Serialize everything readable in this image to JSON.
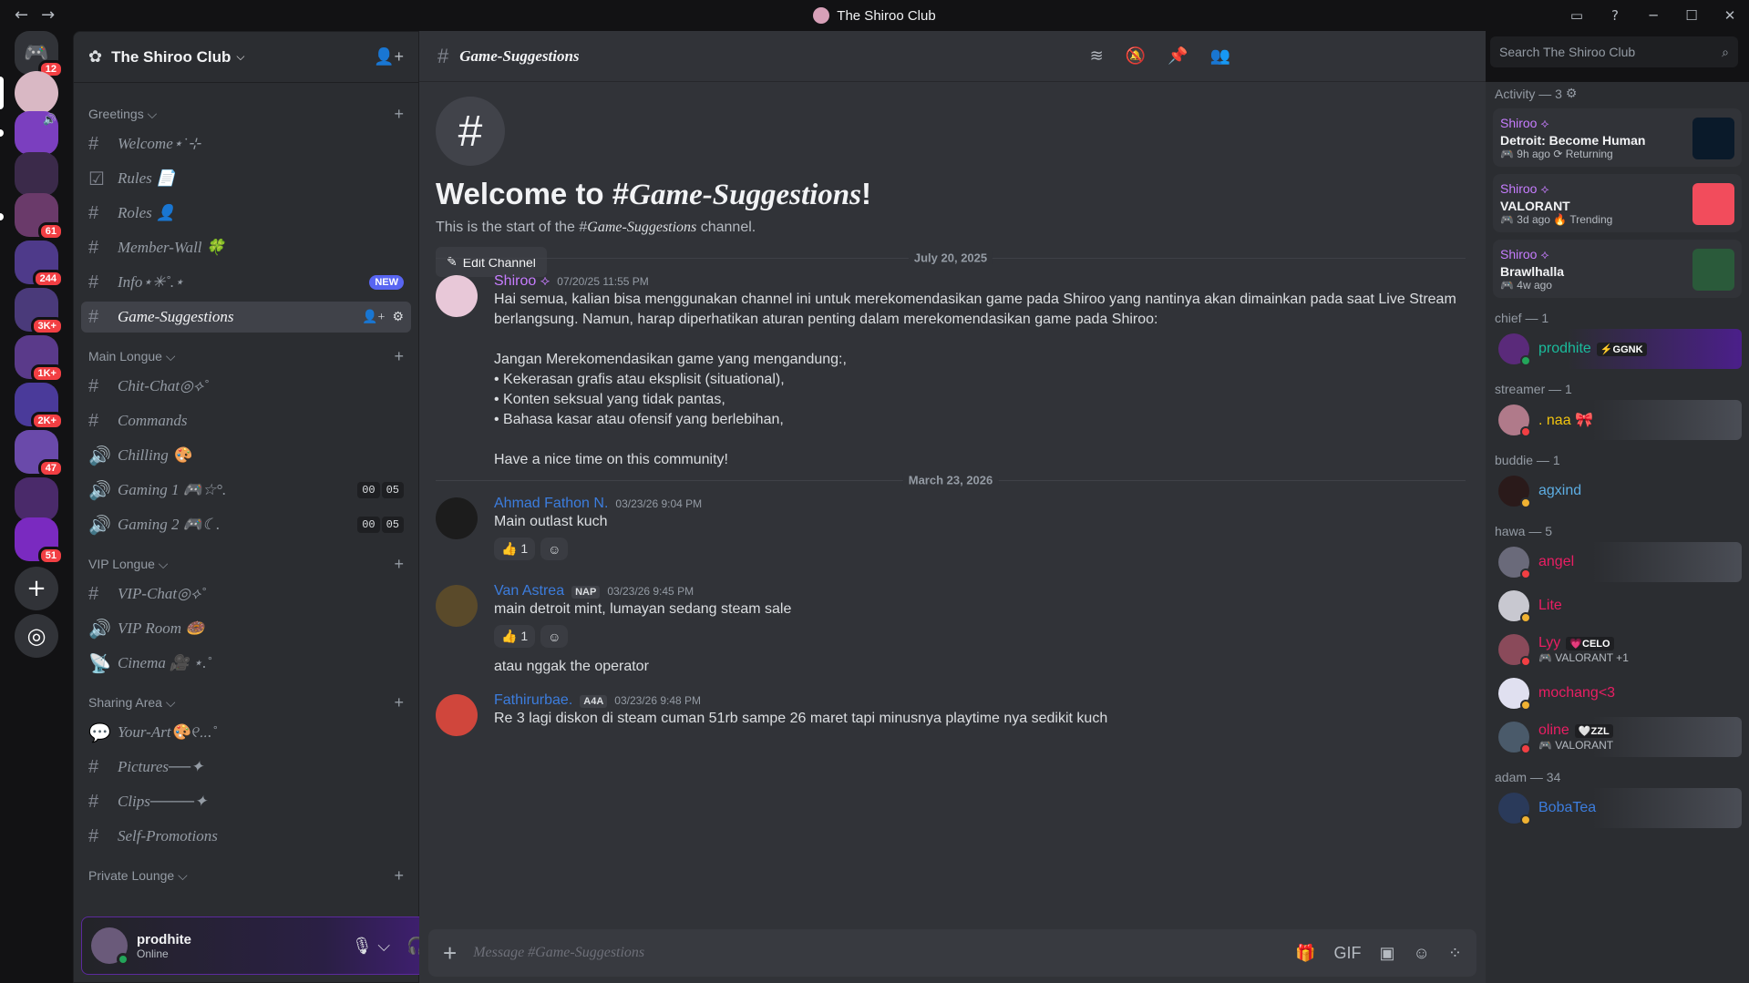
{
  "app": {
    "title": "The Shiroo Club"
  },
  "window": {
    "back": "←",
    "forward": "→",
    "inbox_icon": "inbox-icon",
    "help": "?",
    "minimize": "─",
    "maximize": "☐",
    "close": "✕"
  },
  "guilds": {
    "home_badge": "12",
    "badges": [
      "61",
      "244",
      "3K+",
      "1K+",
      "2K+",
      "47",
      "51"
    ],
    "add": "+",
    "discover": "◎"
  },
  "server": {
    "name": "The Shiroo Club",
    "chevron": "⌵"
  },
  "sidebar": {
    "categories": [
      {
        "label": "Greetings ⌵",
        "channels": [
          {
            "name": "Welcome⋆˙⊹",
            "icon": "#"
          },
          {
            "name": "Rules 📄",
            "icon": "☑"
          },
          {
            "name": "Roles 👤",
            "icon": "#"
          },
          {
            "name": "Member-Wall 🍀",
            "icon": "#"
          },
          {
            "name": "Info⋆✳︎˚.⋆",
            "icon": "#",
            "badge": "NEW"
          },
          {
            "name": "Game-Suggestions",
            "icon": "#",
            "active": true
          }
        ]
      },
      {
        "label": "Main Longue ⌵",
        "channels": [
          {
            "name": "Chit-Chat◎⟡˚",
            "icon": "#"
          },
          {
            "name": "Commands",
            "icon": "#"
          },
          {
            "name": "Chilling 🎨",
            "icon": "🔊"
          },
          {
            "name": "Gaming 1 🎮☆°.",
            "icon": "🔊",
            "counts": [
              "00",
              "05"
            ]
          },
          {
            "name": "Gaming 2 🎮☾.",
            "icon": "🔊",
            "counts": [
              "00",
              "05"
            ]
          }
        ]
      },
      {
        "label": "VIP Longue ⌵",
        "channels": [
          {
            "name": "VIP-Chat◎⟡˚",
            "icon": "#"
          },
          {
            "name": "VIP Room 🍩",
            "icon": "🔊"
          },
          {
            "name": "Cinema 🎥 ⋆.˚",
            "icon": "📡"
          }
        ]
      },
      {
        "label": "Sharing Area ⌵",
        "channels": [
          {
            "name": "Your-Art🎨୧‥.˚",
            "icon": "💬"
          },
          {
            "name": "Pictures──✦",
            "icon": "#"
          },
          {
            "name": "Clips────✦",
            "icon": "#"
          },
          {
            "name": "Self-Promotions",
            "icon": "#"
          }
        ]
      },
      {
        "label": "Private Lounge ⌵",
        "channels": []
      }
    ]
  },
  "user": {
    "name": "prodhite",
    "status": "Online"
  },
  "channel": {
    "name": "Game-Suggestions",
    "welcome_title_prefix": "Welcome to #",
    "welcome_title_name": "Game-Suggestions",
    "welcome_title_suffix": "!",
    "welcome_sub_prefix": "This is the start of the #",
    "welcome_sub_name": "Game-Suggestions",
    "welcome_sub_suffix": " channel.",
    "edit_label": "Edit Channel",
    "composer_placeholder": "Message #Game-Suggestions"
  },
  "search": {
    "placeholder": "Search The Shiroo Club"
  },
  "dividers": [
    "July 20, 2025",
    "March 23, 2026"
  ],
  "messages": [
    {
      "author": "Shiroo ⟡",
      "color": "#c77dff",
      "time": "07/20/25 11:55 PM",
      "text": "Hai semua, kalian bisa menggunakan channel ini untuk merekomendasikan game pada Shiroo yang nantinya akan dimainkan pada saat Live Stream berlangsung. Namun, harap diperhatikan aturan penting dalam merekomendasikan game pada Shiroo:\n\nJangan Merekomendasikan game yang mengandung:,\n• Kekerasan grafis atau eksplisit (situational),\n• Konten seksual yang tidak pantas,\n• Bahasa kasar atau ofensif yang berlebihan,\n\nHave a nice time on this community!"
    },
    {
      "author": "Ahmad Fathon N.",
      "color": "#3c7dde",
      "time": "03/23/26 9:04 PM",
      "text": "Main outlast kuch",
      "reaction": "👍 1"
    },
    {
      "author": "Van Astrea",
      "color": "#3c7dde",
      "tag": "NAP",
      "time": "03/23/26 9:45 PM",
      "text": "main detroit mint, lumayan sedang steam sale",
      "reaction": "👍 1",
      "followup": "atau nggak the operator"
    },
    {
      "author": "Fathirurbae.",
      "color": "#3c7dde",
      "tag": "A4A",
      "time": "03/23/26 9:48 PM",
      "text": "Re 3 lagi diskon di steam cuman 51rb sampe 26 maret tapi minusnya playtime nya sedikit kuch"
    }
  ],
  "members": {
    "activity_label": "Activity — 3",
    "activity": [
      {
        "who": "Shiroo ⟡",
        "game": "Detroit: Become Human",
        "meta": "🎮 9h ago  ⟳ Returning"
      },
      {
        "who": "Shiroo ⟡",
        "game": "VALORANT",
        "meta": "🎮 3d ago  🔥 Trending"
      },
      {
        "who": "Shiroo ⟡",
        "game": "Brawlhalla",
        "meta": "🎮 4w ago"
      }
    ],
    "groups": [
      {
        "label": "chief — 1",
        "members": [
          {
            "name": "prodhite",
            "color": "#1abc9c",
            "tag": "⚡GGNK",
            "status": "#23a55a"
          }
        ]
      },
      {
        "label": "streamer — 1",
        "members": [
          {
            "name": ". naa 🎀",
            "color": "#f1c40f",
            "status": "#f23f43"
          }
        ]
      },
      {
        "label": "buddie — 1",
        "members": [
          {
            "name": "agxind",
            "color": "#5dade2",
            "status": "#f0b232"
          }
        ]
      },
      {
        "label": "hawa — 5",
        "members": [
          {
            "name": "angel",
            "color": "#e91e63",
            "status": "#f23f43"
          },
          {
            "name": "Lite",
            "color": "#e91e63",
            "status": "#f0b232"
          },
          {
            "name": "Lyy",
            "color": "#e91e63",
            "tag": "💗CELO",
            "sub": "🎮 VALORANT +1",
            "status": "#f23f43"
          },
          {
            "name": "mochang<3",
            "color": "#e91e63",
            "status": "#f0b232"
          },
          {
            "name": "oline",
            "color": "#e91e63",
            "tag": "🤍ZZL",
            "sub": "🎮 VALORANT",
            "status": "#f23f43"
          }
        ]
      },
      {
        "label": "adam — 34",
        "members": [
          {
            "name": "BobaTea",
            "color": "#3c7dde",
            "status": "#f0b232"
          }
        ]
      }
    ]
  }
}
